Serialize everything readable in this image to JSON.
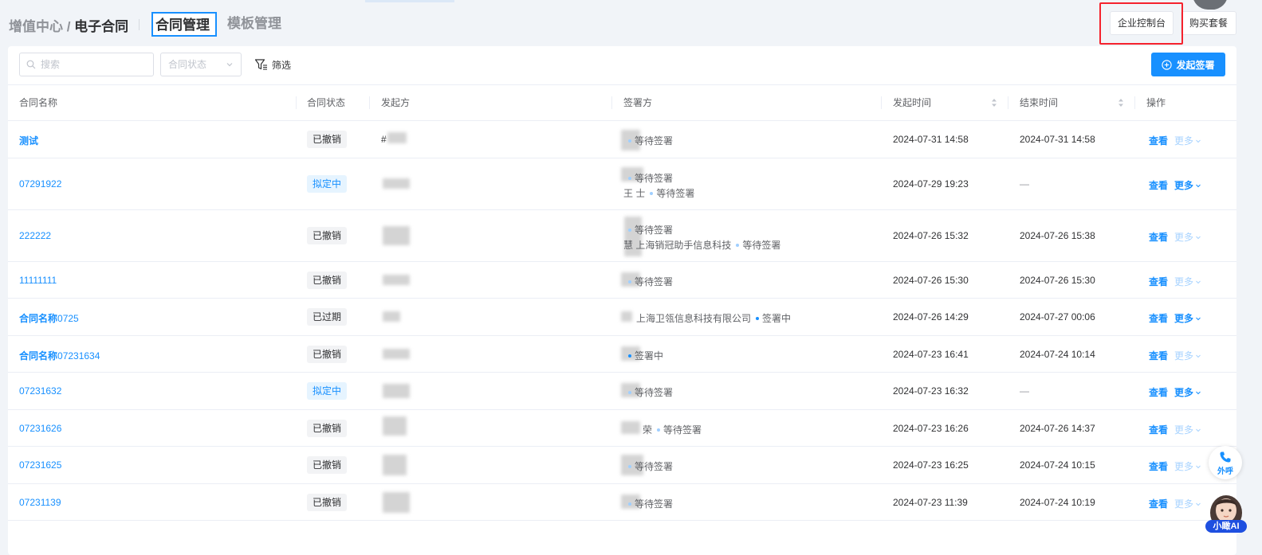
{
  "breadcrumb": {
    "parent": "增值中心 / ",
    "current": "电子合同"
  },
  "tabs": [
    {
      "label": "合同管理",
      "active": true
    },
    {
      "label": "模板管理",
      "active": false
    }
  ],
  "header_buttons": {
    "console": "企业控制台",
    "buy": "购买套餐"
  },
  "toolbar": {
    "search_placeholder": "搜索",
    "status_placeholder": "合同状态",
    "filter_label": "筛选",
    "create_label": "发起签署"
  },
  "columns": [
    "合同名称",
    "合同状态",
    "发起方",
    "签署方",
    "发起时间",
    "结束时间",
    "操作"
  ],
  "actions": {
    "view": "查看",
    "more": "更多"
  },
  "rows": [
    {
      "name_bold": "测试",
      "name_rest": "",
      "status": "已撤销",
      "initiator": "#",
      "signers": [
        {
          "name": "",
          "state": "等待签署"
        }
      ],
      "start": "2024-07-31 14:58",
      "end": "2024-07-31 14:58",
      "more_enabled": false
    },
    {
      "name_bold": "",
      "name_rest": "07291922",
      "status": "拟定中",
      "initiator": "",
      "signers": [
        {
          "name": "",
          "state": "等待签署"
        },
        {
          "name": "王 士",
          "state": "等待签署"
        }
      ],
      "start": "2024-07-29 19:23",
      "end": "—",
      "more_enabled": true
    },
    {
      "name_bold": "",
      "name_rest": "222222",
      "status": "已撤销",
      "initiator": "",
      "signers": [
        {
          "name": "",
          "state": "等待签署"
        },
        {
          "name": "慧 上海销冠助手信息科技",
          "state": "等待签署"
        }
      ],
      "start": "2024-07-26 15:32",
      "end": "2024-07-26 15:38",
      "more_enabled": false
    },
    {
      "name_bold": "",
      "name_rest": "11111111",
      "status": "已撤销",
      "initiator": "",
      "signers": [
        {
          "name": "",
          "state": "等待签署"
        }
      ],
      "start": "2024-07-26 15:30",
      "end": "2024-07-26 15:30",
      "more_enabled": false
    },
    {
      "name_bold": "合同名称",
      "name_rest": "0725",
      "status": "已过期",
      "initiator": "",
      "signers": [
        {
          "name": "上海卫瓴信息科技有限公司",
          "state": "签署中"
        }
      ],
      "start": "2024-07-26 14:29",
      "end": "2024-07-27 00:06",
      "more_enabled": true
    },
    {
      "name_bold": "合同名称",
      "name_rest": "07231634",
      "status": "已撤销",
      "initiator": "",
      "signers": [
        {
          "name": "",
          "state": "签署中"
        }
      ],
      "start": "2024-07-23 16:41",
      "end": "2024-07-24 10:14",
      "more_enabled": false
    },
    {
      "name_bold": "",
      "name_rest": "07231632",
      "status": "拟定中",
      "initiator": "",
      "signers": [
        {
          "name": "",
          "state": "等待签署"
        }
      ],
      "start": "2024-07-23 16:32",
      "end": "—",
      "more_enabled": true
    },
    {
      "name_bold": "",
      "name_rest": "07231626",
      "status": "已撤销",
      "initiator": "",
      "signers": [
        {
          "name": "荣",
          "state": "等待签署"
        }
      ],
      "start": "2024-07-23 16:26",
      "end": "2024-07-26 14:37",
      "more_enabled": false
    },
    {
      "name_bold": "",
      "name_rest": "07231625",
      "status": "已撤销",
      "initiator": "",
      "signers": [
        {
          "name": "",
          "state": "等待签署"
        }
      ],
      "start": "2024-07-23 16:25",
      "end": "2024-07-24 10:15",
      "more_enabled": false
    },
    {
      "name_bold": "",
      "name_rest": "07231139",
      "status": "已撤销",
      "initiator": "",
      "signers": [
        {
          "name": "",
          "state": "等待签署"
        }
      ],
      "start": "2024-07-23 11:39",
      "end": "2024-07-24 10:19",
      "more_enabled": false
    }
  ],
  "floating": {
    "call_label": "外呼",
    "ai_label": "小瞰AI"
  },
  "colors": {
    "primary": "#1890ff",
    "highlight_border": "#f5222d",
    "page_bg": "#f1f4f8"
  }
}
